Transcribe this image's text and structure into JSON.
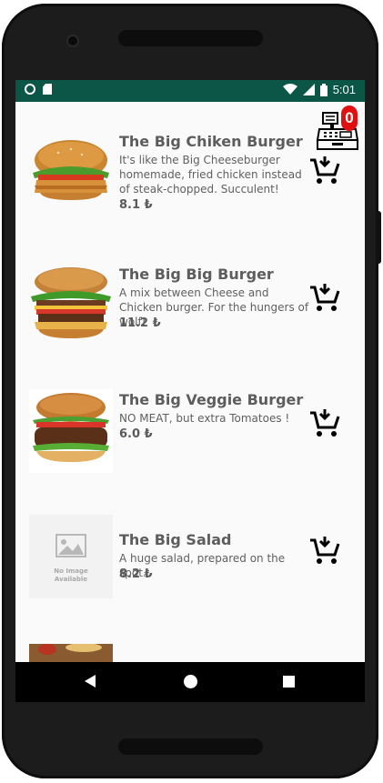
{
  "status_bar": {
    "time": "5:01"
  },
  "cart": {
    "count": "0"
  },
  "menu": [
    {
      "title": "The Big Chiken Burger",
      "description": "It's like the Big Cheeseburger homemade, fried chicken instead of steak-chopped. Succulent!",
      "price": "8.1 ₺"
    },
    {
      "title": "The Big Big Burger",
      "description": "A mix between Cheese and Chicken burger. For the hungers of wolf!",
      "price": "11.2 ₺"
    },
    {
      "title": "The Big Veggie Burger",
      "description": "NO MEAT, but extra Tomatoes !",
      "price": "6.0 ₺"
    },
    {
      "title": "The Big Salad",
      "description": "A huge salad, prepared on the spot.",
      "price": "8.2 ₺",
      "placeholder_line1": "No Image",
      "placeholder_line2": "Available"
    }
  ],
  "colors": {
    "status_bar": "#0b5647",
    "badge": "#e01010",
    "screen_bg": "#fafafa"
  },
  "icons": {
    "add_to_cart": "cart-download-icon",
    "cart": "cash-register-icon"
  }
}
